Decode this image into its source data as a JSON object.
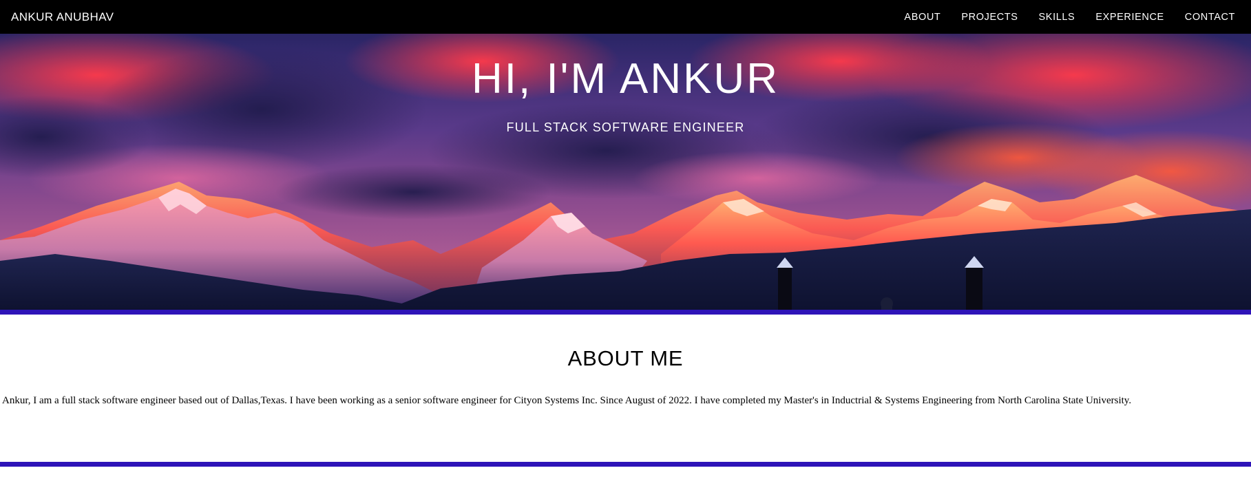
{
  "navbar": {
    "brand": "ANKUR ANUBHAV",
    "links": [
      "ABOUT",
      "PROJECTS",
      "SKILLS",
      "EXPERIENCE",
      "CONTACT"
    ]
  },
  "hero": {
    "title": "HI, I'M ANKUR",
    "subtitle": "FULL STACK SOFTWARE ENGINEER"
  },
  "about": {
    "heading": "ABOUT ME",
    "text": "Ankur, I am a full stack software engineer based out of Dallas,Texas. I have been working as a senior software engineer for Cityon Systems Inc. Since August of 2022. I have completed my Master's in Inductrial & Systems Engineering from North Carolina State University."
  },
  "colors": {
    "navbar_bg": "#000000",
    "accent_divider": "#2e14b8",
    "text_light": "#ffffff",
    "text_dark": "#000000"
  }
}
